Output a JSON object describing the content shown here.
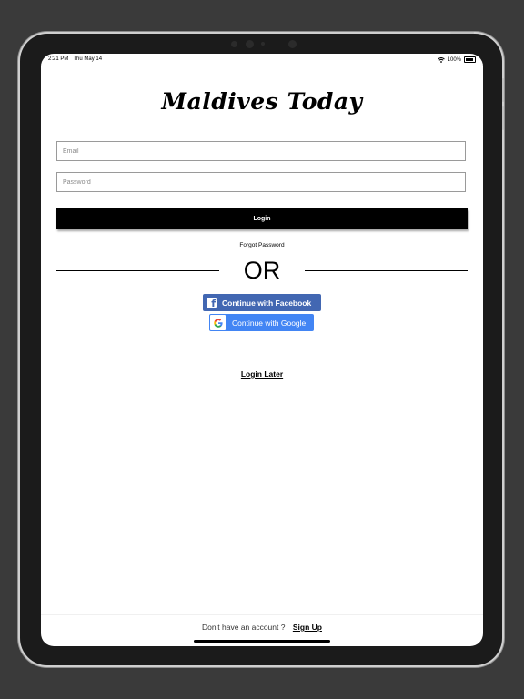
{
  "status_bar": {
    "time": "2:21 PM",
    "date": "Thu May 14",
    "battery": "100%"
  },
  "app": {
    "logo": "Maldives Today"
  },
  "form": {
    "email_placeholder": "Email",
    "password_placeholder": "Password",
    "login_label": "Login",
    "forgot_password": "Forgot Password"
  },
  "divider": {
    "or": "OR"
  },
  "social": {
    "facebook_label": "Continue with Facebook",
    "google_label": "Continue with Google"
  },
  "login_later": "Login Later",
  "footer": {
    "prompt": "Don't have an account ?",
    "signup": "Sign Up"
  },
  "colors": {
    "facebook": "#4267b2",
    "google": "#4285f4",
    "primary_button": "#000000"
  }
}
